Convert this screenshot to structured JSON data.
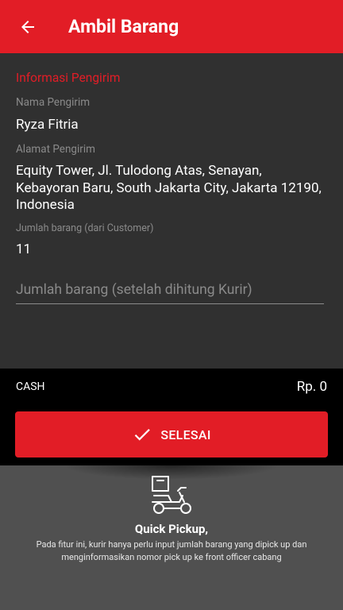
{
  "header": {
    "title": "Ambil Barang",
    "back_icon": "arrow-left-icon",
    "color": "#e21d26"
  },
  "sender": {
    "section_title": "Informasi Pengirim",
    "name_label": "Nama Pengirim",
    "name_value": "Ryza Fitria",
    "address_label": "Alamat Pengirim",
    "address_value": "Equity Tower, Jl. Tulodong Atas, Senayan, Kebayoran Baru, South Jakarta City, Jakarta 12190, Indonesia",
    "qty_label": "Jumlah barang (dari Customer)",
    "qty_value": "11"
  },
  "courier_input": {
    "placeholder": "Jumlah barang (setelah dihitung Kurir)",
    "value": ""
  },
  "payment": {
    "method": "CASH",
    "amount": "Rp. 0"
  },
  "finish_button": {
    "label": "SELESAI",
    "icon": "check-icon"
  },
  "info": {
    "icon": "delivery-scooter-icon",
    "title": "Quick Pickup,",
    "description": "Pada fitur ini, kurir hanya perlu input jumlah barang yang dipick up dan menginformasikan nomor pick up ke front officer cabang"
  }
}
